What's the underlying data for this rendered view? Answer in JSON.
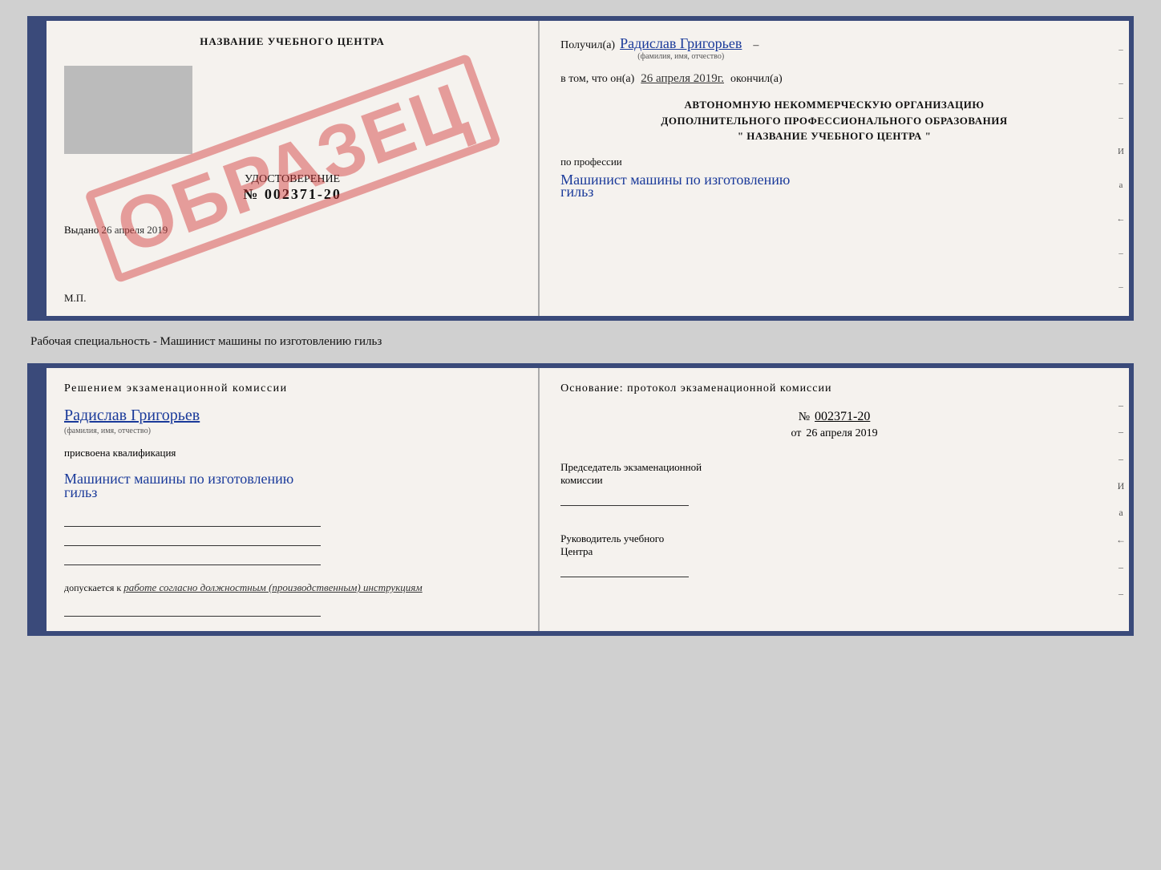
{
  "topDoc": {
    "left": {
      "title": "НАЗВАНИЕ УЧЕБНОГО ЦЕНТРА",
      "stampText": "ОБРАЗЕЦ",
      "certLabel": "УДОСТОВЕРЕНИЕ",
      "certNumber": "№ 002371-20",
      "issuedLabel": "Выдано",
      "issuedDate": "26 апреля 2019",
      "mpLabel": "М.П."
    },
    "right": {
      "receivedLabel": "Получил(а)",
      "recipientName": "Радислав Григорьев",
      "nameSubLabel": "(фамилия, имя, отчество)",
      "completedLabel": "окончил(а)",
      "dateLabel": "в том, что он(а)",
      "completedDate": "26 апреля 2019г.",
      "orgLine1": "АВТОНОМНУЮ НЕКОММЕРЧЕСКУЮ ОРГАНИЗАЦИЮ",
      "orgLine2": "ДОПОЛНИТЕЛЬНОГО ПРОФЕССИОНАЛЬНОГО ОБРАЗОВАНИЯ",
      "orgLine3": "\" НАЗВАНИЕ УЧЕБНОГО ЦЕНТРА \"",
      "professionLabel": "по профессии",
      "professionName": "Машинист машины по изготовлению",
      "professionName2": "гильз",
      "sideMarks": [
        "–",
        "–",
        "–",
        "И",
        "а",
        "←",
        "–",
        "–"
      ]
    }
  },
  "separatorLabel": "Рабочая специальность - Машинист машины по изготовлению гильз",
  "bottomDoc": {
    "left": {
      "decisionText": "Решением  экзаменационной  комиссии",
      "recipientName": "Радислав Григорьев",
      "nameSubLabel": "(фамилия, имя, отчество)",
      "assignedLabel": "присвоена квалификация",
      "qualificationName": "Машинист машины по изготовлению",
      "qualificationName2": "гильз",
      "allowedLabel": "допускается к",
      "allowedText": "работе согласно должностным (производственным) инструкциям"
    },
    "right": {
      "basisLabel": "Основание: протокол экзаменационной  комиссии",
      "numberLabel": "№",
      "number": "002371-20",
      "dateFromLabel": "от",
      "dateFrom": "26 апреля 2019",
      "chairmanTitle1": "Председатель экзаменационной",
      "chairmanTitle2": "комиссии",
      "headTitle1": "Руководитель учебного",
      "headTitle2": "Центра",
      "sideMarks": [
        "–",
        "–",
        "–",
        "И",
        "а",
        "←",
        "–",
        "–"
      ]
    }
  }
}
